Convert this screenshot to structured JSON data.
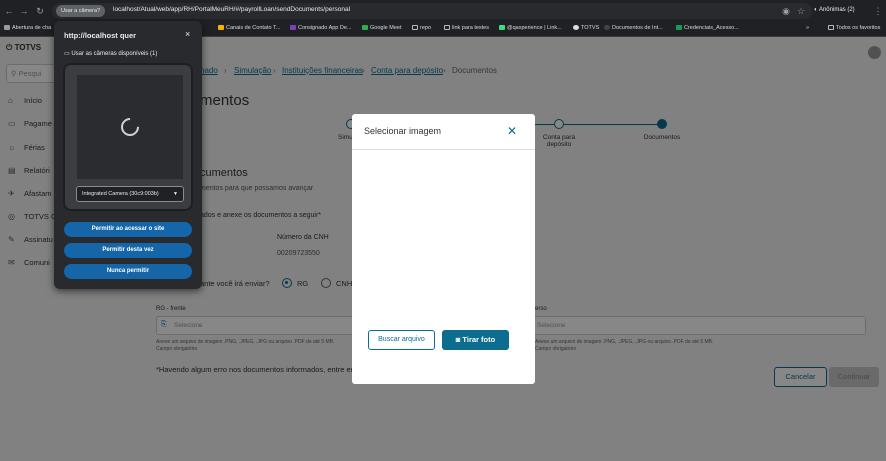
{
  "browser": {
    "camera_chip": "Usar a câmera?",
    "url": "localhost/Atual/web/app/RH/PortalMeuRH/#/payrollLoan/sendDocuments/personal",
    "profile": "Anônimas (2)",
    "bookmarks": [
      {
        "label": "Abertura de cha"
      },
      {
        "label": "Canais de Contato T..."
      },
      {
        "label": "Consignado App De..."
      },
      {
        "label": "Google Meet"
      },
      {
        "label": "repo"
      },
      {
        "label": "link para testes"
      },
      {
        "label": "@qaxperience | Link..."
      },
      {
        "label": "TOTVS"
      },
      {
        "label": "Documentos de Int..."
      },
      {
        "label": "Credenciais_Acesso..."
      }
    ],
    "all_bookmarks": "Todos os favoritos"
  },
  "sidebar": {
    "logo": "TOTVS",
    "search_placeholder": "Pesqui",
    "items": [
      {
        "label": "Início",
        "icon": "home-icon"
      },
      {
        "label": "Pagame",
        "icon": "payment-icon"
      },
      {
        "label": "Férias",
        "icon": "sun-icon"
      },
      {
        "label": "Relatóri",
        "icon": "report-icon"
      },
      {
        "label": "Afastam",
        "icon": "leave-icon"
      },
      {
        "label": "TOTVS C",
        "icon": "totvs-icon"
      },
      {
        "label": "Assinatu",
        "icon": "signature-icon"
      },
      {
        "label": "Comuni",
        "icon": "chat-icon"
      }
    ]
  },
  "breadcrumb": {
    "items": [
      "nado",
      "Simulação",
      "Instituições financeiras",
      "Conta para depósito"
    ],
    "current": "Documentos"
  },
  "page": {
    "title": "mentos",
    "steps": [
      {
        "label": "Simu"
      },
      {
        "label": "Conta para depósito"
      },
      {
        "label": "Documentos"
      }
    ],
    "section_title": "cumentos",
    "section_sub": "mentos para que possamos avançar",
    "instruction": "ados e anexe os documentos a seguir*",
    "cnh_label": "Número da CNH",
    "cnh_value": "00209723550",
    "doc_question": "ante você irá enviar?",
    "radio_rg": "RG",
    "radio_cnh": "CNH",
    "rg_front_label": "RG - frente",
    "rg_back_label": "erso",
    "select_placeholder": "Selecione",
    "hint": "Anexe um arquivo de imagem .PNG, .JPEG, .JPG ou arquivo .PDF de até 5 MB.",
    "required": "Campo obrigatório",
    "error_note": "*Havendo algum erro nos documentos informados, entre em",
    "cancel": "Cancelar",
    "continue": "Continuar"
  },
  "modal": {
    "title": "Selecionar imagem",
    "browse": "Buscar arquivo",
    "take_photo": "Tirar foto"
  },
  "permission": {
    "title": "http://localhost quer",
    "use_cameras": "Usar as câmeras disponíveis (1)",
    "camera_option": "Integrated Camera (30c9:003b)",
    "allow_always": "Permitir ao acessar o site",
    "allow_once": "Permitir desta vez",
    "never": "Nunca permitir"
  }
}
